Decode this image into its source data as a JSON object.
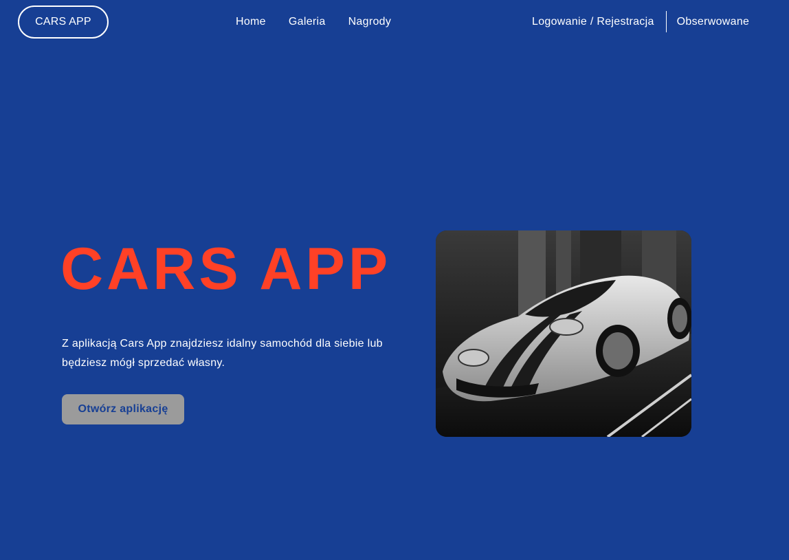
{
  "header": {
    "logo_label": "CARS APP",
    "nav": [
      {
        "label": "Home"
      },
      {
        "label": "Galeria"
      },
      {
        "label": "Nagrody"
      }
    ],
    "auth_label": "Logowanie / Rejestracja",
    "watchlist_label": "Obserwowane"
  },
  "hero": {
    "title": "CARS APP",
    "description": "Z aplikacją Cars App znajdziesz idalny samochód dla siebie lub będziesz mógł sprzedać własny.",
    "cta_label": "Otwórz aplikację",
    "image_subject": "black-and-white sports car photo"
  },
  "colors": {
    "background": "#173f94",
    "title_accent": "#ff4126",
    "button_bg": "#9b9b9b",
    "button_text": "#173f94",
    "text": "#ffffff"
  }
}
